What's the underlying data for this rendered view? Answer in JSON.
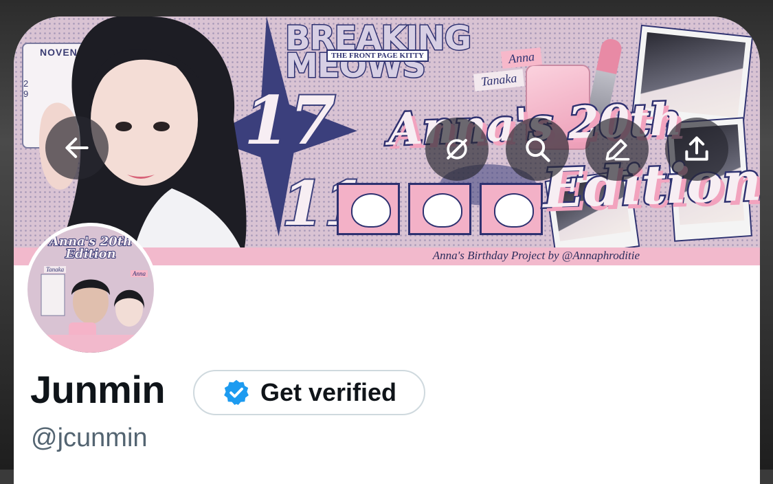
{
  "banner": {
    "calendar_month": "NOVEN",
    "calendar_digits": [
      "2",
      "9"
    ],
    "date_day": "17",
    "date_month": "11",
    "headline": "BREAKING MEOWS",
    "headline_sub": "THE FRONT PAGE KITTY",
    "tag_anna": "Anna",
    "tag_tanaka": "Tanaka",
    "title_line1": "Anna's 20th",
    "title_line2": "Edition",
    "credit": "Anna's Birthday Project by @Annaphroditie"
  },
  "toolbar": {
    "back_icon": "arrow-left-icon",
    "grok_icon": "grok-icon",
    "search_icon": "search-icon",
    "edit_icon": "edit-icon",
    "share_icon": "share-icon"
  },
  "avatar": {
    "title": "Anna's 20th Edition",
    "tag_tanaka": "Tanaka",
    "tag_anna": "Anna"
  },
  "profile": {
    "display_name": "Junmin",
    "verify_label": "Get verified",
    "handle": "@jcunmin"
  },
  "colors": {
    "verified_badge": "#1d9bf0",
    "banner_navy": "#2e3170",
    "banner_pink": "#f2b9cc",
    "handle_gray": "#536471"
  }
}
